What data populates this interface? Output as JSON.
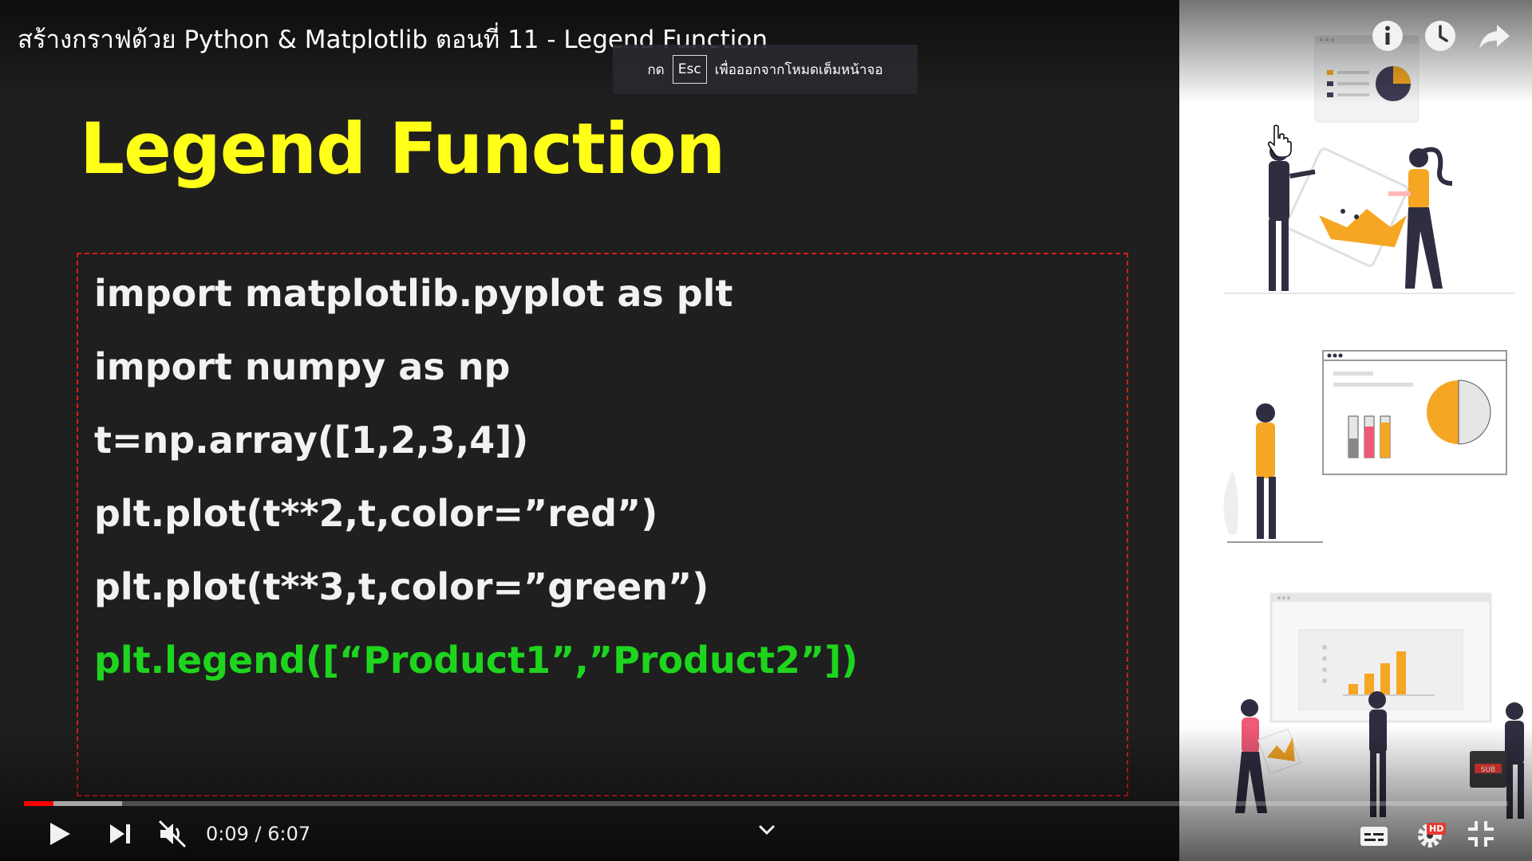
{
  "video": {
    "title": "สร้างกราฟด้วย Python & Matplotlib ตอนที่ 11 - Legend Function",
    "time_current": "0:09",
    "time_separator": " / ",
    "time_total": "6:07",
    "progress_played": 0.02,
    "progress_buffered": 0.066,
    "hd_badge": "HD",
    "sub_badge": "SUB"
  },
  "toast": {
    "prefix": "กด",
    "key": "Esc",
    "suffix": "เพื่อออกจากโหมดเต็มหน้าจอ"
  },
  "slide": {
    "title": "Legend Function",
    "code_lines": [
      "import matplotlib.pyplot as plt",
      "import numpy as np",
      "t=np.array([1,2,3,4])",
      "plt.plot(t**2,t,color=”red”)",
      "plt.plot(t**3,t,color=”green”)",
      "plt.legend([“Product1”,”Product2”])"
    ]
  },
  "colors": {
    "title_yellow": "#ffff17",
    "code_white": "#f2f2f2",
    "code_green": "#1ed51e",
    "dashed_border": "#d81b1b",
    "progress_red": "#ff0000",
    "illus_orange": "#f5a623",
    "illus_pink": "#ef5a78",
    "illus_dark": "#2f2e41"
  },
  "icons": {
    "top_right": [
      "info-icon",
      "watch-later-icon",
      "share-icon"
    ],
    "bottom_left": [
      "play-icon",
      "next-icon",
      "volume-muted-icon"
    ],
    "bottom_right": [
      "subtitles-icon",
      "settings-icon",
      "exit-fullscreen-icon"
    ]
  }
}
